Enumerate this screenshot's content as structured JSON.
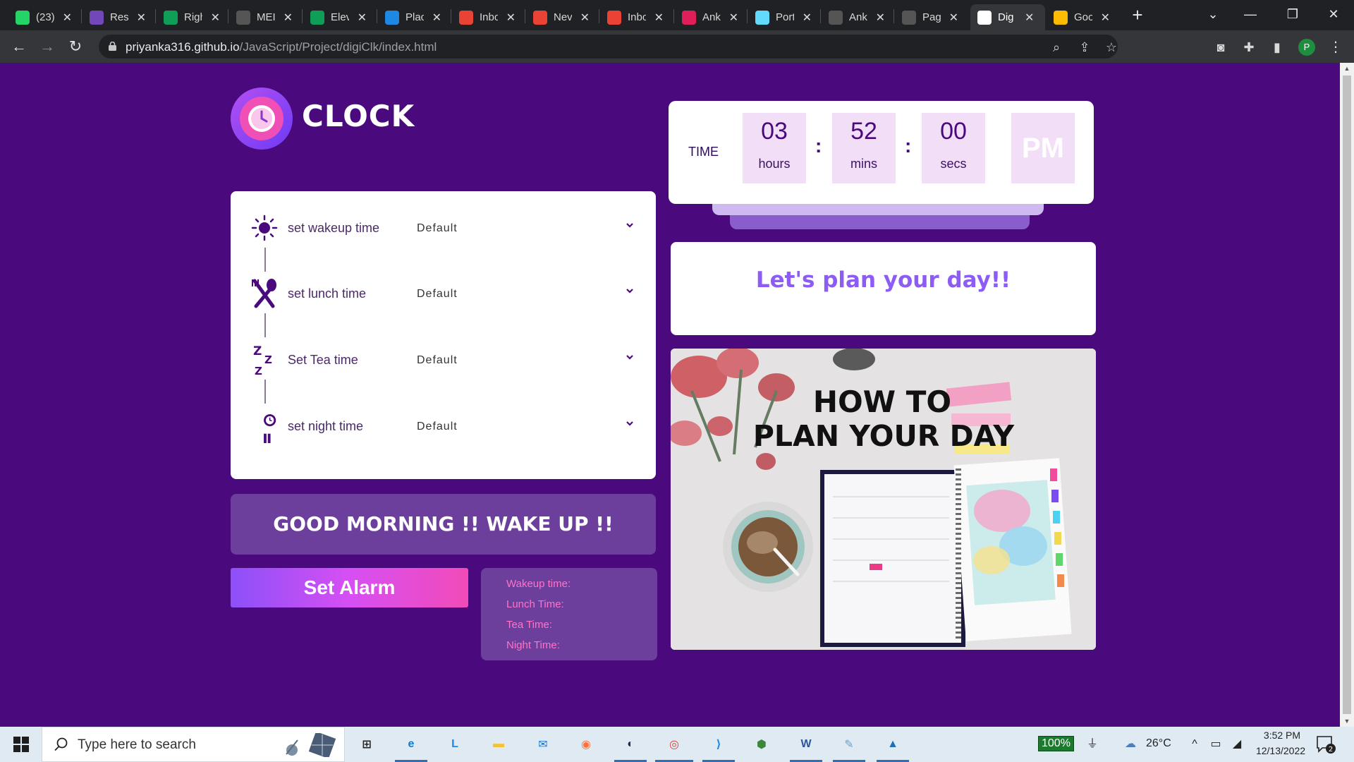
{
  "browser": {
    "tabs": [
      {
        "title": "(23)",
        "favicon": "whatsapp-icon",
        "color": "#25d366"
      },
      {
        "title": "Rest",
        "favicon": "forms-icon",
        "color": "#7248b9"
      },
      {
        "title": "Righ",
        "favicon": "sheets-icon",
        "color": "#0f9d58"
      },
      {
        "title": "MEI",
        "favicon": "github-icon",
        "color": "#555555"
      },
      {
        "title": "Elev",
        "favicon": "sheets-icon",
        "color": "#0f9d58"
      },
      {
        "title": "Plac",
        "favicon": "pb-icon",
        "color": "#1e88e5"
      },
      {
        "title": "Inbo",
        "favicon": "gmail-icon",
        "color": "#ea4335"
      },
      {
        "title": "Nev",
        "favicon": "gmail-icon",
        "color": "#ea4335"
      },
      {
        "title": "Inbo",
        "favicon": "gmail-icon",
        "color": "#ea4335"
      },
      {
        "title": "Ank",
        "favicon": "slack-icon",
        "color": "#e01e5a"
      },
      {
        "title": "Port",
        "favicon": "react-icon",
        "color": "#61dafb"
      },
      {
        "title": "Ank",
        "favicon": "github-icon",
        "color": "#555555"
      },
      {
        "title": "Pag",
        "favicon": "github-icon",
        "color": "#555555"
      },
      {
        "title": "Dig",
        "favicon": "globe-icon",
        "color": "#ffffff"
      },
      {
        "title": "Goo",
        "favicon": "classroom-icon",
        "color": "#fbbc04"
      }
    ],
    "active_tab_index": 13,
    "url_host": "priyanka316.github.io",
    "url_path": "/JavaScript/Project/digiClk/index.html",
    "profile_initial": "P"
  },
  "page": {
    "brand": "CLOCK",
    "timer": {
      "label": "TIME",
      "hours": "03",
      "hours_unit": "hours",
      "mins": "52",
      "mins_unit": "mins",
      "secs": "00",
      "secs_unit": "secs",
      "separator": ":",
      "ampm": "PM"
    },
    "plan_heading": "Let's plan your day!!",
    "plan_image": {
      "line1": "HOW TO",
      "line2": "PLAN YOUR DAY"
    },
    "settings": [
      {
        "label": "set wakeup time",
        "value": "Default",
        "icon": "sun-icon"
      },
      {
        "label": "set lunch time",
        "value": "Default",
        "icon": "fork-spoon-icon"
      },
      {
        "label": "Set Tea time",
        "value": "Default",
        "icon": "zzz-icon"
      },
      {
        "label": "set night time",
        "value": "Default",
        "icon": "moon-clock-icon"
      }
    ],
    "greeting": "GOOD MORNING !! WAKE UP !!",
    "set_alarm_label": "Set Alarm",
    "alarm_times": [
      {
        "label": "Wakeup time:"
      },
      {
        "label": "Lunch Time:"
      },
      {
        "label": "Tea Time:"
      },
      {
        "label": "Night Time:"
      }
    ]
  },
  "taskbar": {
    "search_placeholder": "Type here to search",
    "battery": "100%",
    "temperature": "26°C",
    "time": "3:52 PM",
    "date": "12/13/2022",
    "notification_count": "2",
    "apps": [
      {
        "name": "task-view-icon"
      },
      {
        "name": "edge-icon",
        "color": "#0c7cd5"
      },
      {
        "name": "l-app-icon",
        "color": "#1e88e5"
      },
      {
        "name": "file-explorer-icon",
        "color": "#f3c131"
      },
      {
        "name": "mail-icon",
        "color": "#1976d2"
      },
      {
        "name": "firefox-icon",
        "color": "#ff7139"
      },
      {
        "name": "eclipse-icon",
        "color": "#2c2255"
      },
      {
        "name": "chrome-icon",
        "color": "#db4437"
      },
      {
        "name": "vscode-icon",
        "color": "#1f88e5"
      },
      {
        "name": "nodejs-icon",
        "color": "#3c873a"
      },
      {
        "name": "word-icon",
        "color": "#2b579a"
      },
      {
        "name": "notepad-icon",
        "color": "#5da6d6"
      },
      {
        "name": "photos-icon",
        "color": "#1e6fb7"
      }
    ]
  }
}
